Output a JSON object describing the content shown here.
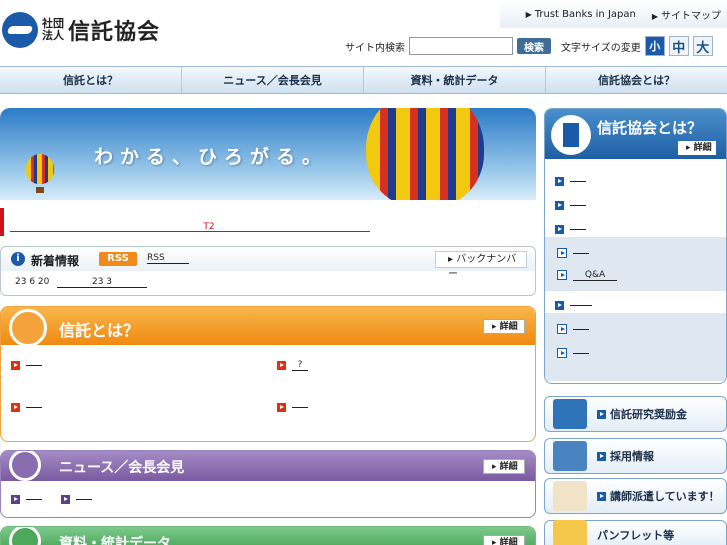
{
  "header": {
    "logo_sub": "社団\n法人",
    "logo_name": "信託協会",
    "top_links": [
      "Trust Banks in Japan",
      "サイトマップ"
    ],
    "search_label": "サイト内検索",
    "search_value": "",
    "search_button": "検索",
    "font_size_label": "文字サイズの変更",
    "font_sizes": [
      "小",
      "中",
      "大"
    ]
  },
  "gnav": [
    "信託とは？",
    "ニュース／会長会見",
    "資料・統計データ",
    "信託協会とは？"
  ],
  "hero": {
    "text": "わかる、ひろがる。"
  },
  "notice": {
    "links": [
      "",
      "T2",
      ""
    ]
  },
  "news": {
    "title": "新着情報",
    "rss_badge": "RSS",
    "rss_link": "RSS",
    "back_number": "バックナンバー",
    "date": "23 6 20",
    "link": "23 3"
  },
  "sections": [
    {
      "title": "信託とは？",
      "detail": "詳細",
      "items": [
        "",
        "?",
        "",
        ""
      ]
    },
    {
      "title": "ニュース／会長会見",
      "detail": "詳細",
      "items": [
        "",
        ""
      ]
    },
    {
      "title": "資料・統計データ",
      "detail": "詳細"
    }
  ],
  "sidebar": {
    "title": "信託協会とは？",
    "detail": "詳細",
    "items": [
      "",
      "",
      "",
      "",
      "Q&A",
      "",
      "",
      ""
    ],
    "buttons": [
      "信託研究奨励金",
      "採用情報",
      "講師派遣しています！",
      "パンフレット等"
    ]
  },
  "colors": {
    "brand_blue": "#1a5aa8",
    "accent_red": "#d0101a",
    "orange": "#f08a1a",
    "purple": "#7a5aa0",
    "green": "#3a9a4a"
  }
}
